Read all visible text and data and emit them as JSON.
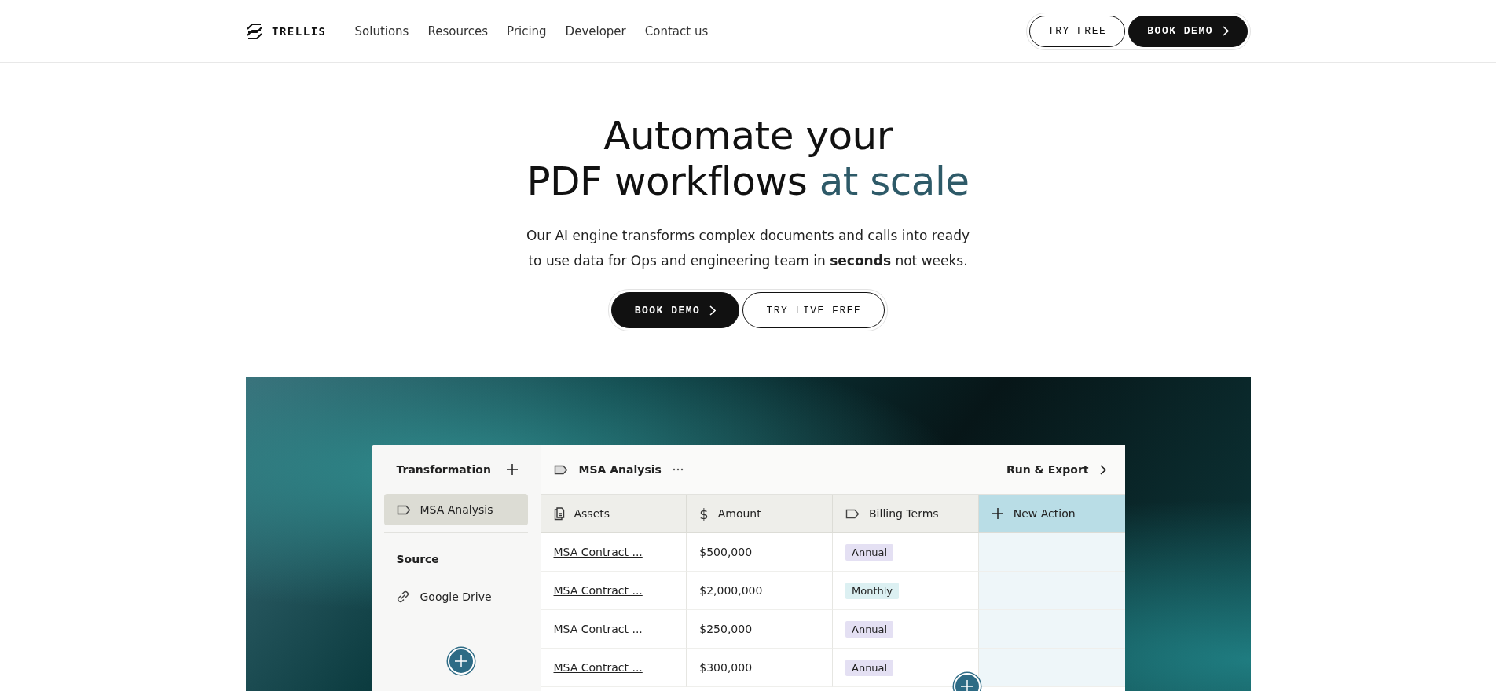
{
  "header": {
    "brand": "TRELLIS",
    "nav": [
      {
        "label": "Solutions"
      },
      {
        "label": "Resources"
      },
      {
        "label": "Pricing"
      },
      {
        "label": "Developer"
      },
      {
        "label": "Contact us"
      }
    ],
    "try_button": "TRY FREE",
    "demo_button": "BOOK DEMO"
  },
  "hero": {
    "title_line_1": "Automate your",
    "title_line_2": "PDF workflows",
    "title_accent": "at scale",
    "subtitle_line_1": "Our AI engine transforms complex documents and calls into ready",
    "subtitle_line_2": "to use data for Ops and engineering team in **seconds** not weeks.",
    "demo_button": "BOOK DEMO",
    "try_button": "TRY LIVE FREE"
  },
  "app": {
    "sidebar": {
      "title": "Transformation",
      "items": [
        {
          "label": "MSA Analysis",
          "selected": true
        }
      ],
      "section_title": "Source",
      "sources": [
        {
          "label": "Google Drive"
        }
      ]
    },
    "toolbar": {
      "title": "MSA Analysis",
      "action": "Run & Export"
    },
    "columns": [
      {
        "label": "Assets",
        "kind": "document"
      },
      {
        "label": "Amount",
        "kind": "currency",
        "symbol": "$"
      },
      {
        "label": "Billing Terms",
        "kind": "tag"
      },
      {
        "label": "New Action",
        "kind": "add"
      }
    ],
    "rows": [
      {
        "asset": "MSA Contract ...",
        "amount": "$500,000",
        "billing": {
          "label": "Annual",
          "color": "#e4e0f3"
        }
      },
      {
        "asset": "MSA Contract ...",
        "amount": "$2,000,000",
        "billing": {
          "label": "Monthly",
          "color": "#dcf0f2"
        }
      },
      {
        "asset": "MSA Contract ...",
        "amount": "$250,000",
        "billing": {
          "label": "Annual",
          "color": "#e4e0f3"
        }
      },
      {
        "asset": "MSA Contract ...",
        "amount": "$300,000",
        "billing": {
          "label": "Annual",
          "color": "#e4e0f3"
        }
      }
    ]
  }
}
